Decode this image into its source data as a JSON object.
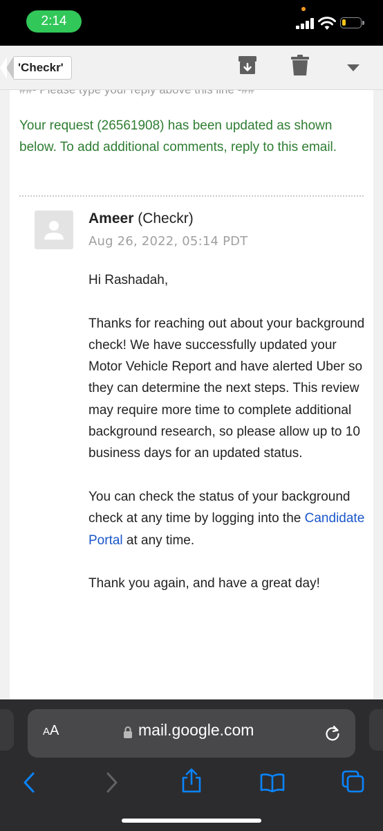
{
  "status_bar": {
    "time": "2:14"
  },
  "header": {
    "back_label": "'Checkr'",
    "icons": [
      "archive-icon",
      "trash-icon",
      "dropdown-icon"
    ]
  },
  "email": {
    "reply_line": "##- Please type your reply above this line -##",
    "update_notice": "Your request (26561908) has been updated as shown below. To add additional comments, reply to this email.",
    "sender_name": "Ameer",
    "sender_org": "(Checkr)",
    "date": "Aug 26, 2022, 05:14 PDT",
    "greeting": "Hi Rashadah,",
    "paragraph1": "Thanks for reaching out about your background check! We have successfully updated your Motor Vehicle Report and have alerted Uber so they can determine the next steps. This review may require more time to complete additional background research, so please allow up to 10 business days for an updated status.",
    "paragraph2_before": "You can check the status of your background check at any time by logging into the ",
    "paragraph2_link": "Candidate Portal",
    "paragraph2_after": " at any time.",
    "closing": "Thank you again, and have a great day!"
  },
  "safari": {
    "aa_label_small": "A",
    "aa_label_large": "A",
    "url": "mail.google.com",
    "toolbar_icons": [
      "back-icon",
      "forward-icon",
      "share-icon",
      "bookmarks-icon",
      "tabs-icon"
    ]
  },
  "colors": {
    "notice_green": "#2e7d32",
    "link_blue": "#1a56c9",
    "time_pill_green": "#32c759",
    "safari_accent": "#0a84ff"
  }
}
